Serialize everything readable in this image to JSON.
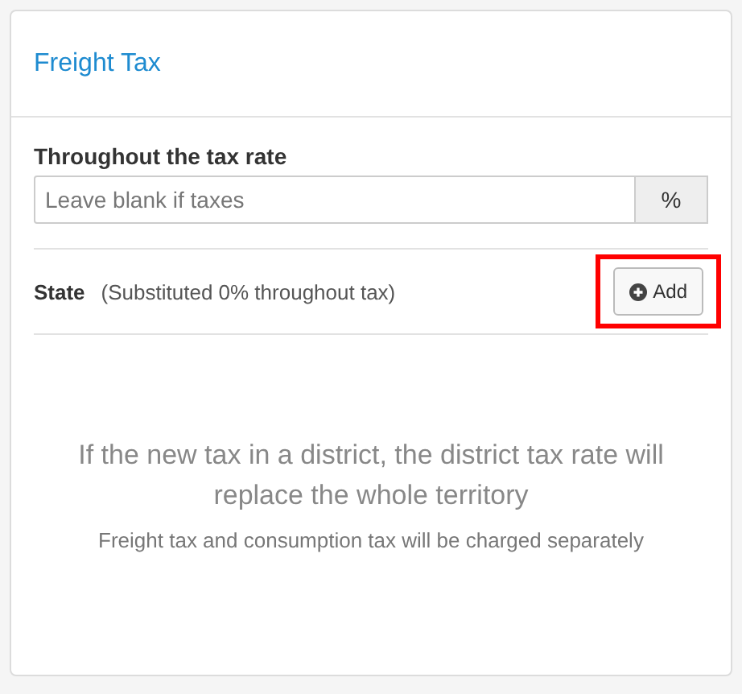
{
  "panel": {
    "title": "Freight Tax"
  },
  "rate_field": {
    "label": "Throughout the tax rate",
    "placeholder": "Leave blank if taxes",
    "addon": "%"
  },
  "state_row": {
    "label": "State",
    "note": "(Substituted 0% throughout tax)",
    "button": {
      "label": "Add",
      "highlighted": true
    }
  },
  "empty_message": {
    "main": "If the new tax in a district, the district tax rate will replace the whole territory",
    "sub": "Freight tax and consumption tax will be charged separately"
  }
}
